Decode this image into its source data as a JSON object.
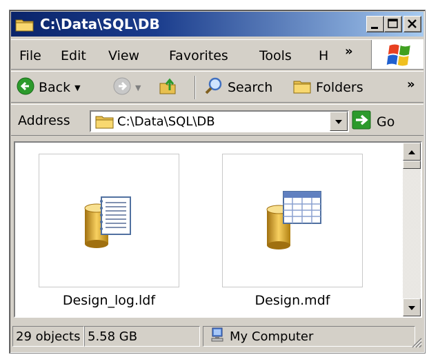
{
  "window": {
    "title": "C:\\Data\\SQL\\DB"
  },
  "menu": {
    "file": "File",
    "edit": "Edit",
    "view": "View",
    "favorites": "Favorites",
    "tools": "Tools",
    "help": "H",
    "more": "»"
  },
  "toolbar": {
    "back": "Back",
    "search": "Search",
    "folders": "Folders",
    "more": "»"
  },
  "address": {
    "label": "Address",
    "value": "C:\\Data\\SQL\\DB",
    "go": "Go"
  },
  "files": [
    {
      "name": "Design_log.ldf",
      "icon": "database-log-icon"
    },
    {
      "name": "Design.mdf",
      "icon": "database-table-icon"
    }
  ],
  "status": {
    "objects": "29 objects",
    "size": "5.58 GB",
    "location": "My Computer"
  },
  "colors": {
    "title_start": "#0a246a",
    "title_end": "#a6caf0",
    "chrome": "#d4d0c8",
    "go_green": "#2c9a2c",
    "db_gold": "#e8b020"
  }
}
